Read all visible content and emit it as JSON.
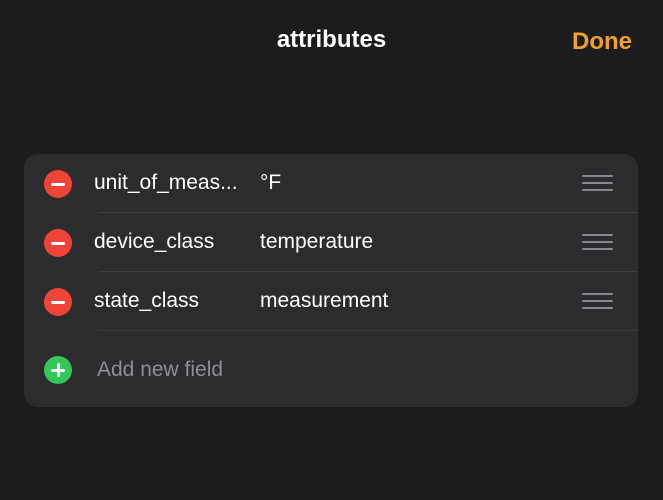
{
  "nav": {
    "title": "attributes",
    "done_label": "Done"
  },
  "fields": [
    {
      "key": "unit_of_meas...",
      "value": "°F"
    },
    {
      "key": "device_class",
      "value": "temperature"
    },
    {
      "key": "state_class",
      "value": "measurement"
    }
  ],
  "add_field": {
    "placeholder": "Add new field"
  },
  "colors": {
    "background": "#1c1c1e",
    "card": "#2c2c2e",
    "accent": "#f0a030",
    "delete": "#f04438",
    "add": "#34c759"
  },
  "icons": {
    "delete": "minus-circle-icon",
    "add": "plus-circle-icon",
    "reorder": "reorder-handle-icon"
  }
}
